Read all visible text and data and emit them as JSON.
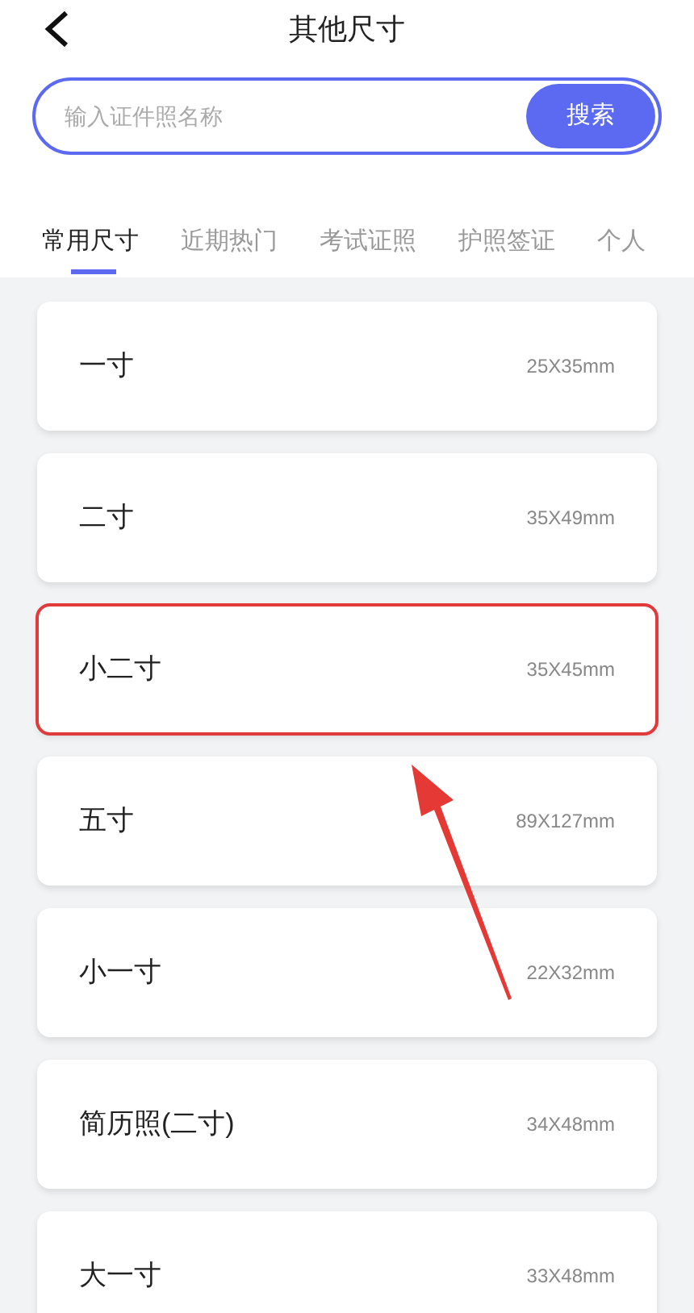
{
  "header": {
    "title": "其他尺寸"
  },
  "search": {
    "placeholder": "输入证件照名称",
    "button": "搜索"
  },
  "tabs": [
    {
      "label": "常用尺寸",
      "selected": true
    },
    {
      "label": "近期热门",
      "selected": false
    },
    {
      "label": "考试证照",
      "selected": false
    },
    {
      "label": "护照签证",
      "selected": false
    },
    {
      "label": "个人",
      "selected": false
    }
  ],
  "sizes": [
    {
      "name": "一寸",
      "dimensions": "25X35mm",
      "highlighted": false
    },
    {
      "name": "二寸",
      "dimensions": "35X49mm",
      "highlighted": false
    },
    {
      "name": "小二寸",
      "dimensions": "35X45mm",
      "highlighted": true
    },
    {
      "name": "五寸",
      "dimensions": "89X127mm",
      "highlighted": false
    },
    {
      "name": "小一寸",
      "dimensions": "22X32mm",
      "highlighted": false
    },
    {
      "name": "简历照(二寸)",
      "dimensions": "34X48mm",
      "highlighted": false
    },
    {
      "name": "大一寸",
      "dimensions": "33X48mm",
      "highlighted": false
    }
  ]
}
